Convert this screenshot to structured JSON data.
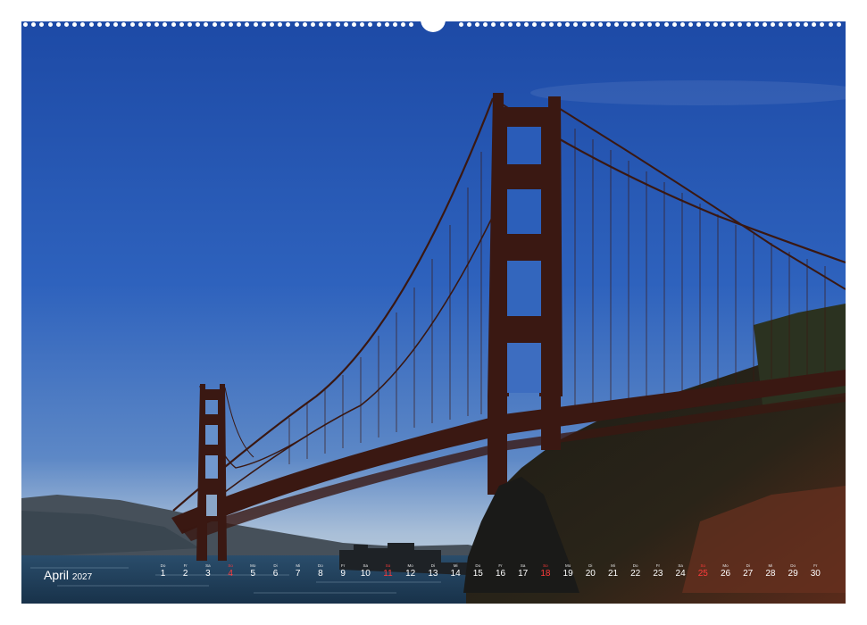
{
  "calendar": {
    "month": "April",
    "year": "2027",
    "days": [
      {
        "wd": "Do",
        "n": "1",
        "holiday": false
      },
      {
        "wd": "Fr",
        "n": "2",
        "holiday": false
      },
      {
        "wd": "Sa",
        "n": "3",
        "holiday": false
      },
      {
        "wd": "So",
        "n": "4",
        "holiday": true
      },
      {
        "wd": "Mo",
        "n": "5",
        "holiday": false
      },
      {
        "wd": "Di",
        "n": "6",
        "holiday": false
      },
      {
        "wd": "Mi",
        "n": "7",
        "holiday": false
      },
      {
        "wd": "Do",
        "n": "8",
        "holiday": false
      },
      {
        "wd": "Fr",
        "n": "9",
        "holiday": false
      },
      {
        "wd": "Sa",
        "n": "10",
        "holiday": false
      },
      {
        "wd": "So",
        "n": "11",
        "holiday": true
      },
      {
        "wd": "Mo",
        "n": "12",
        "holiday": false
      },
      {
        "wd": "Di",
        "n": "13",
        "holiday": false
      },
      {
        "wd": "Mi",
        "n": "14",
        "holiday": false
      },
      {
        "wd": "Do",
        "n": "15",
        "holiday": false
      },
      {
        "wd": "Fr",
        "n": "16",
        "holiday": false
      },
      {
        "wd": "Sa",
        "n": "17",
        "holiday": false
      },
      {
        "wd": "So",
        "n": "18",
        "holiday": true
      },
      {
        "wd": "Mo",
        "n": "19",
        "holiday": false
      },
      {
        "wd": "Di",
        "n": "20",
        "holiday": false
      },
      {
        "wd": "Mi",
        "n": "21",
        "holiday": false
      },
      {
        "wd": "Do",
        "n": "22",
        "holiday": false
      },
      {
        "wd": "Fr",
        "n": "23",
        "holiday": false
      },
      {
        "wd": "Sa",
        "n": "24",
        "holiday": false
      },
      {
        "wd": "So",
        "n": "25",
        "holiday": true
      },
      {
        "wd": "Mo",
        "n": "26",
        "holiday": false
      },
      {
        "wd": "Di",
        "n": "27",
        "holiday": false
      },
      {
        "wd": "Mi",
        "n": "28",
        "holiday": false
      },
      {
        "wd": "Do",
        "n": "29",
        "holiday": false
      },
      {
        "wd": "Fr",
        "n": "30",
        "holiday": false
      }
    ]
  },
  "colors": {
    "sky_top": "#1f4fa8",
    "sky_bottom": "#9bb6d6",
    "bridge": "#3a1a12",
    "water": "#1e3a55",
    "holiday": "#ff3b3b"
  }
}
